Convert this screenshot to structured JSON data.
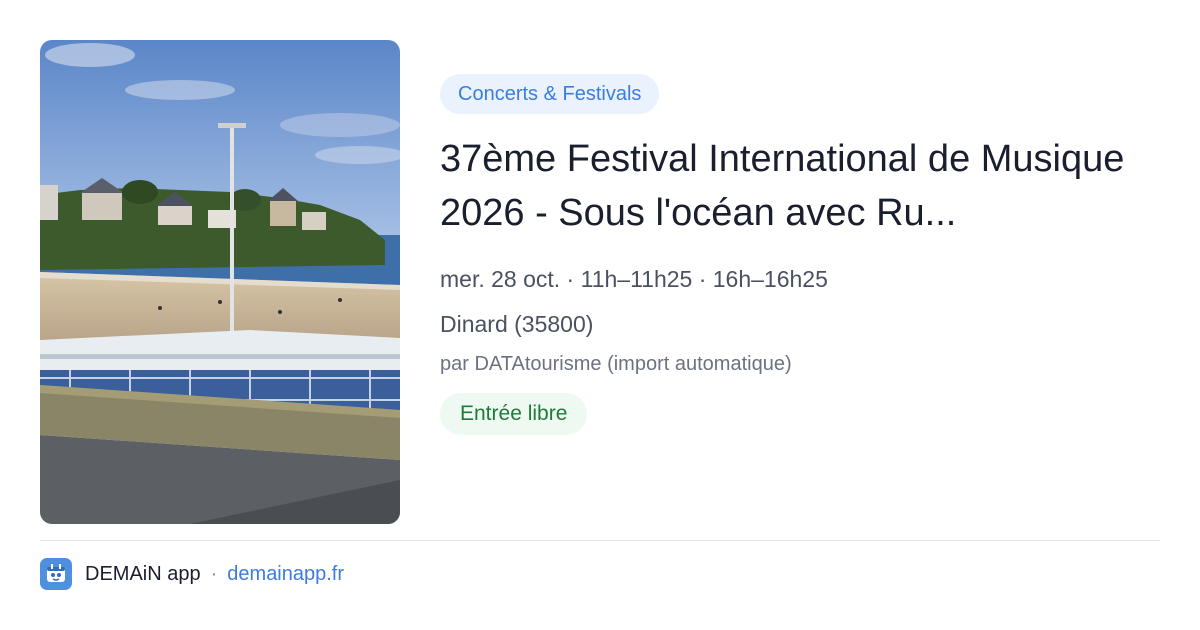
{
  "card": {
    "image_description": "Beach with lamppost",
    "category": "Concerts & Festivals",
    "title": "37ème Festival International de Musique 2026 - Sous l'océan avec Ru...",
    "datetime": "mer. 28 oct. · 11h–11h25 · 16h–16h25",
    "location": "Dinard (35800)",
    "source": "par DATAtourisme (import automatique)",
    "price": "Entrée libre"
  },
  "footer": {
    "app_name": "DEMAiN app",
    "separator": "·",
    "link": "demainapp.fr"
  },
  "colors": {
    "accent": "#3b7ddd",
    "category_bg": "#eaf2fd",
    "price_text": "#1f7a3a",
    "price_bg": "#eefaf1",
    "title_text": "#1a1f2e"
  },
  "icons": {
    "logo": "demain-logo-icon"
  }
}
